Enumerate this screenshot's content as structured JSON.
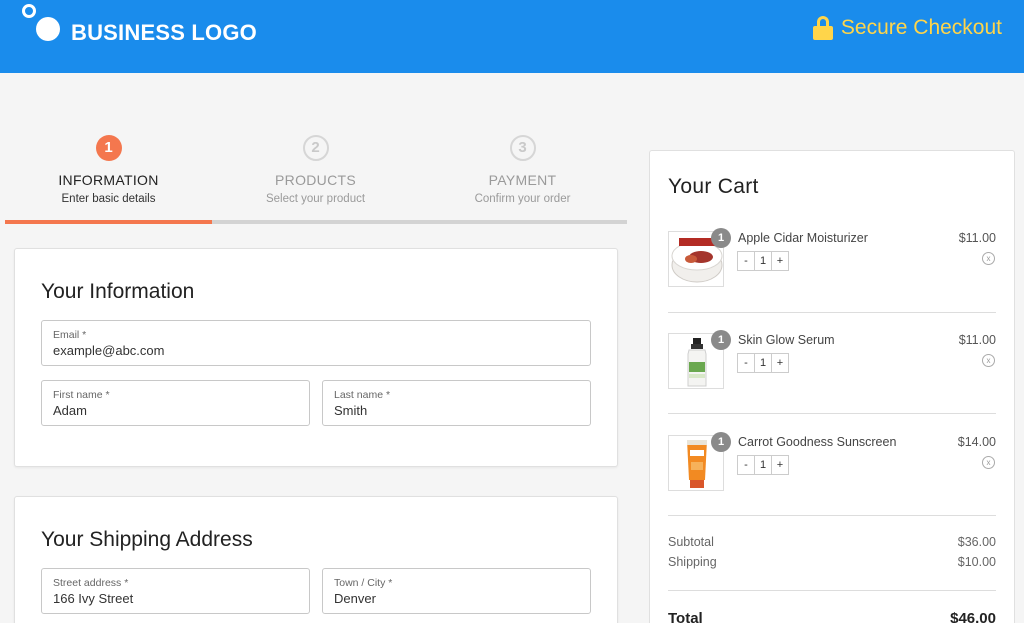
{
  "header": {
    "logo_text": "BUSINESS LOGO",
    "secure_label": "Secure Checkout",
    "bg_color": "#1a8cec",
    "secure_color": "#ffd54a"
  },
  "steps": [
    {
      "number": "1",
      "title": "INFORMATION",
      "subtitle": "Enter basic details",
      "active": true
    },
    {
      "number": "2",
      "title": "PRODUCTS",
      "subtitle": "Select your product",
      "active": false
    },
    {
      "number": "3",
      "title": "PAYMENT",
      "subtitle": "Confirm your order",
      "active": false
    }
  ],
  "progress": {
    "completed_fraction": 0.333,
    "accent_color": "#f4774e"
  },
  "information": {
    "title": "Your Information",
    "email": {
      "label": "Email *",
      "value": "example@abc.com"
    },
    "first_name": {
      "label": "First name *",
      "value": "Adam"
    },
    "last_name": {
      "label": "Last name *",
      "value": "Smith"
    }
  },
  "shipping": {
    "title": "Your Shipping Address",
    "street": {
      "label": "Street address *",
      "value": "166 Ivy Street"
    },
    "city": {
      "label": "Town / City *",
      "value": "Denver"
    }
  },
  "cart": {
    "title": "Your Cart",
    "items": [
      {
        "name": "Apple Cidar Moisturizer",
        "price": "$11.00",
        "qty": "1",
        "badge": "1",
        "minus": "-",
        "plus": "+",
        "remove": "x"
      },
      {
        "name": "Skin Glow Serum",
        "price": "$11.00",
        "qty": "1",
        "badge": "1",
        "minus": "-",
        "plus": "+",
        "remove": "x"
      },
      {
        "name": "Carrot Goodness Sunscreen",
        "price": "$14.00",
        "qty": "1",
        "badge": "1",
        "minus": "-",
        "plus": "+",
        "remove": "x"
      }
    ],
    "subtotal_label": "Subtotal",
    "subtotal_value": "$36.00",
    "shipping_label": "Shipping",
    "shipping_value": "$10.00",
    "total_label": "Total",
    "total_value": "$46.00"
  }
}
